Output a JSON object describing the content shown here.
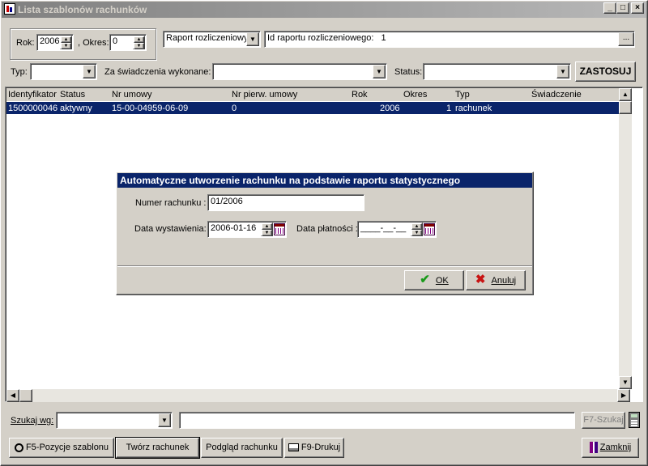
{
  "window": {
    "title": "Lista szablonów rachunków",
    "minimize": "_",
    "maximize": "□",
    "close": "×"
  },
  "filters": {
    "rok_label": "Rok:",
    "rok_value": "2006",
    "okres_label": ", Okres:",
    "okres_value": "0",
    "raport_type": "Raport rozliczeniowy",
    "raport_id_label": "Id raportu rozliczeniowego:",
    "raport_id_value": "1",
    "browse_label": "...",
    "typ_label": "Typ:",
    "typ_value": "",
    "swiadczenia_label": "Za świadczenia wykonane:",
    "swiadczenia_value": "",
    "status_label": "Status:",
    "status_value": "",
    "apply_label": "ZASTOSUJ"
  },
  "table": {
    "columns": [
      "Identyfikator",
      "Status",
      "Nr umowy",
      "Nr pierw. umowy",
      "Rok",
      "Okres",
      "Typ",
      "Świadczenie"
    ],
    "rows": [
      [
        "1500000046",
        "aktywny",
        "15-00-04959-06-09",
        "0",
        "2006",
        "1",
        "rachunek",
        ""
      ]
    ]
  },
  "dialog": {
    "title": "Automatyczne utworzenie rachunku na podstawie raportu statystycznego",
    "numer_label": "Numer rachunku :",
    "numer_value": "01/2006",
    "data_wyst_label": "Data wystawienia:",
    "data_wyst_value": "2006-01-16",
    "data_plat_label": "Data płatności :",
    "data_plat_value": "____-__-__",
    "ok_label": "OK",
    "cancel_label": "Anuluj"
  },
  "search": {
    "label": "Szukaj wg:",
    "field_value": "",
    "text_value": "",
    "button_label": "F7-Szukaj"
  },
  "footer": {
    "positions_label": "F5-Pozycje szablonu",
    "create_label": "Twórz rachunek",
    "preview_label": "Podgląd rachunku",
    "print_label": "F9-Drukuj",
    "close_label": "Zamknij"
  },
  "colors": {
    "selection": "#0a246a",
    "face": "#d4d0c8",
    "ok_check": "#1a9a1a",
    "cancel_x": "#c81414"
  }
}
